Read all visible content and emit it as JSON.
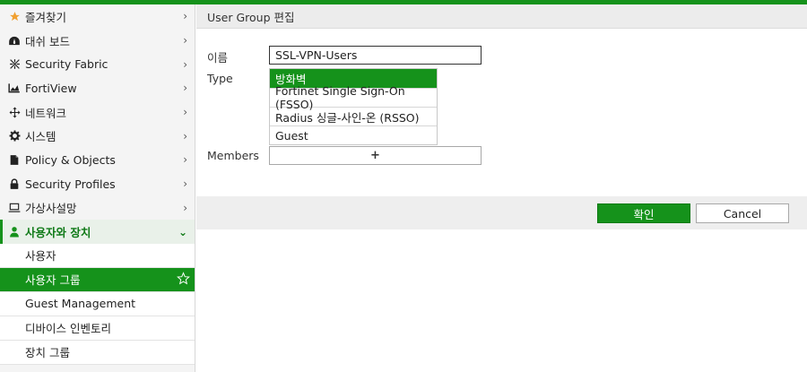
{
  "colors": {
    "accent": "#15921b",
    "star": "#f0a030"
  },
  "sidebar": {
    "items": [
      {
        "label": "즐겨찾기",
        "icon": "star-icon"
      },
      {
        "label": "대쉬 보드",
        "icon": "dashboard-icon"
      },
      {
        "label": "Security Fabric",
        "icon": "fabric-icon"
      },
      {
        "label": "FortiView",
        "icon": "chart-icon"
      },
      {
        "label": "네트워크",
        "icon": "network-icon"
      },
      {
        "label": "시스템",
        "icon": "gear-icon"
      },
      {
        "label": "Policy & Objects",
        "icon": "policy-icon"
      },
      {
        "label": "Security Profiles",
        "icon": "lock-icon"
      },
      {
        "label": "가상사설망",
        "icon": "laptop-icon"
      },
      {
        "label": "사용자와 장치",
        "icon": "user-icon"
      }
    ],
    "sub_items": [
      {
        "label": "사용자"
      },
      {
        "label": "사용자 그룹"
      },
      {
        "label": "Guest Management"
      },
      {
        "label": "디바이스 인벤토리"
      },
      {
        "label": "장치 그룹"
      }
    ]
  },
  "header": {
    "title": "User Group 편집"
  },
  "form": {
    "name_label": "이름",
    "name_value": "SSL-VPN-Users",
    "type_label": "Type",
    "type_options": [
      {
        "label": "방화벽",
        "selected": true
      },
      {
        "label": "Fortinet Single Sign-On (FSSO)"
      },
      {
        "label": "Radius 싱글-사인-온 (RSSO)"
      },
      {
        "label": "Guest"
      }
    ],
    "members_label": "Members",
    "members_add": "+"
  },
  "footer": {
    "ok_label": "확인",
    "cancel_label": "Cancel"
  }
}
